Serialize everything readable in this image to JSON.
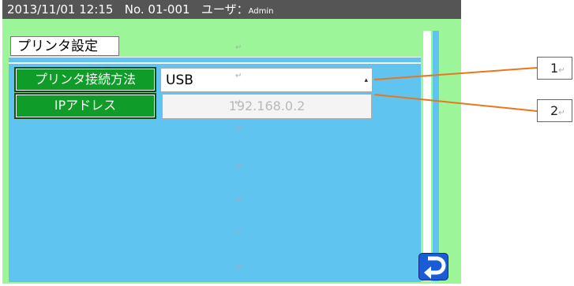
{
  "status_bar": {
    "datetime": "2013/11/01  12:15",
    "machine_no": "No. 01-001",
    "user_label": "ユーザ：",
    "user_name": "Admin"
  },
  "screen": {
    "title": "プリンタ設定",
    "rows": [
      {
        "label": "プリンタ接続方法",
        "value": "USB",
        "control": "select"
      },
      {
        "label": "IPアドレス",
        "value": "192.168.0.2",
        "control": "disabled-input"
      }
    ],
    "return_button_icon": "return-arrow-icon"
  },
  "callouts": [
    {
      "number": "1"
    },
    {
      "number": "2"
    }
  ],
  "paragraph_mark": "↵",
  "colors": {
    "status_bar": "#555555",
    "screen_bg": "#9df59a",
    "panel_bg": "#5fc4ef",
    "label_button": "#0f9c28",
    "callout_line": "#e9761e",
    "return_button": "#1a5bd8"
  }
}
